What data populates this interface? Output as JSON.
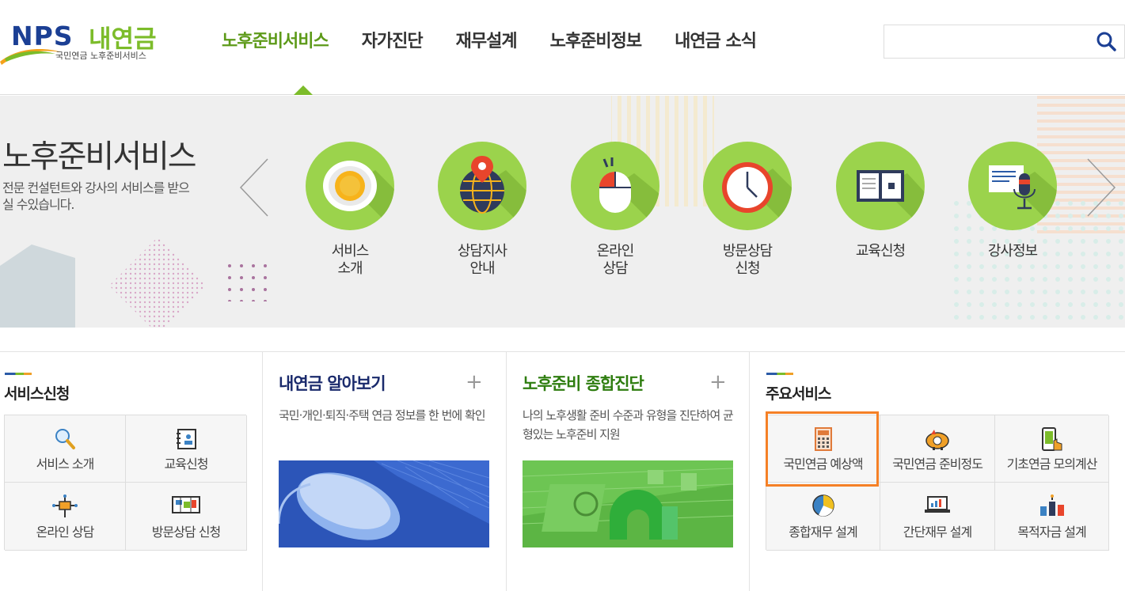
{
  "header": {
    "logo": {
      "brand": "NPS",
      "name": "내연금",
      "subtitle": "국민연금 노후준비서비스"
    },
    "nav": [
      {
        "label": "노후준비서비스",
        "active": true
      },
      {
        "label": "자가진단",
        "active": false
      },
      {
        "label": "재무설계",
        "active": false
      },
      {
        "label": "노후준비정보",
        "active": false
      },
      {
        "label": "내연금 소식",
        "active": false
      }
    ],
    "search": {
      "value": "",
      "placeholder": "",
      "icon": "search-icon"
    }
  },
  "hero": {
    "title": "노후준비서비스",
    "description": "전문 컨설턴트와 강사의 서비스를 받으실 수있습니다.",
    "services": [
      {
        "label": "서비스\n소개",
        "icon": "coffee-cup-icon"
      },
      {
        "label": "상담지사\n안내",
        "icon": "globe-pin-icon"
      },
      {
        "label": "온라인\n상담",
        "icon": "mouse-icon"
      },
      {
        "label": "방문상담\n신청",
        "icon": "clock-icon"
      },
      {
        "label": "교육신청",
        "icon": "book-icon"
      },
      {
        "label": "강사정보",
        "icon": "microphone-icon"
      }
    ]
  },
  "service_apply": {
    "title": "서비스신청",
    "items": [
      {
        "label": "서비스 소개",
        "icon": "magnifier-icon"
      },
      {
        "label": "교육신청",
        "icon": "notebook-icon"
      },
      {
        "label": "온라인 상담",
        "icon": "network-icon"
      },
      {
        "label": "방문상담 신청",
        "icon": "map-icon"
      }
    ]
  },
  "card_pension": {
    "title": "내연금 알아보기",
    "plus": "+",
    "description": "국민·개인·퇴직·주택 연금 정보를 한 번에 확인"
  },
  "card_diagnosis": {
    "title": "노후준비 종합진단",
    "plus": "+",
    "description": "나의 노후생활 준비 수준과 유형을 진단하여 균형있는 노후준비 지원"
  },
  "main_services": {
    "title": "주요서비스",
    "items": [
      {
        "label": "국민연금 예상액",
        "icon": "calculator-icon",
        "highlighted": true
      },
      {
        "label": "국민연금 준비정도",
        "icon": "piggy-bank-icon"
      },
      {
        "label": "기초연금 모의계산",
        "icon": "phone-touch-icon"
      },
      {
        "label": "종합재무 설계",
        "icon": "pie-chart-icon"
      },
      {
        "label": "간단재무 설계",
        "icon": "laptop-chart-icon"
      },
      {
        "label": "목적자금 설계",
        "icon": "bar-chart-icon"
      }
    ]
  },
  "colors": {
    "brand_blue": "#1b3f94",
    "brand_green": "#7cbc2a",
    "nav_active": "#5d9a19",
    "circle_green": "#9bd34c",
    "highlight": "#f58026",
    "title_navy": "#1a2a6c",
    "title_green": "#2e7d0f"
  }
}
